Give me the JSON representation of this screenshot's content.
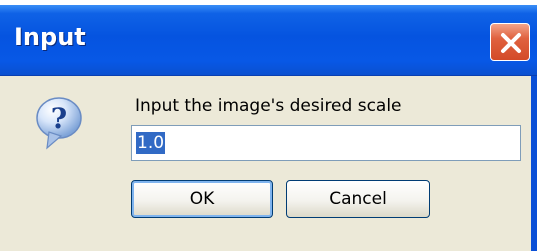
{
  "dialog": {
    "title": "Input",
    "prompt": "Input the image's desired scale",
    "input_value": "1.0",
    "ok_label": "OK",
    "cancel_label": "Cancel"
  },
  "icons": {
    "dialog_icon": "question-icon",
    "close": "close-icon"
  },
  "colors": {
    "titlebar": "#0554e0",
    "client_bg": "#ece9d8",
    "close_button": "#d34a28",
    "selection": "#316ac5"
  }
}
